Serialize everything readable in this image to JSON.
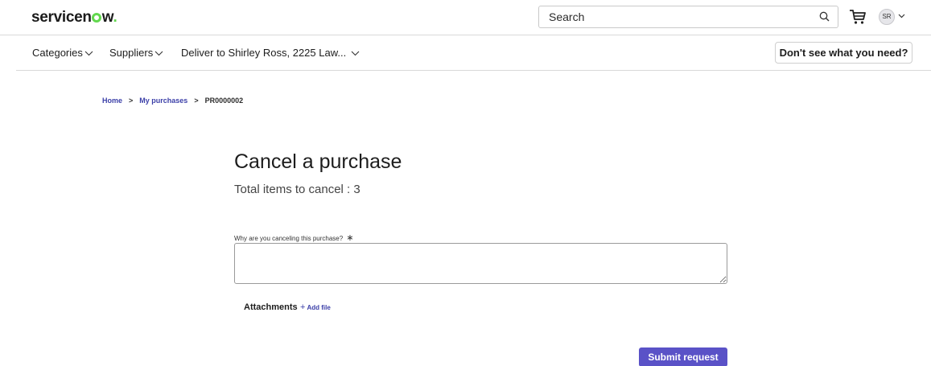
{
  "header": {
    "logo_text": "servicenow",
    "search": {
      "placeholder": "Search",
      "value": ""
    },
    "avatar_initials": "SR"
  },
  "nav": {
    "categories_label": "Categories",
    "suppliers_label": "Suppliers",
    "deliver_label": "Deliver to Shirley Ross, 2225 Law...",
    "dont_see_label": "Don't see what you need?"
  },
  "breadcrumb": {
    "home": "Home",
    "sep": ">",
    "my_purchases": "My purchases",
    "current": "PR0000002"
  },
  "main": {
    "title": "Cancel a purchase",
    "subtitle": "Total items to cancel : 3",
    "reason_label": "Why are you canceling this purchase?",
    "required_mark": "∗",
    "reason_value": "",
    "attachments_label": "Attachments",
    "add_file_plus": "+",
    "add_file_label": "Add file",
    "submit_label": "Submit request"
  },
  "colors": {
    "brand_green": "#62d84e",
    "link": "#3b3fa8",
    "primary_button": "#5a52c7"
  },
  "icons": [
    "search-icon",
    "cart-icon",
    "chevron-down-icon"
  ]
}
